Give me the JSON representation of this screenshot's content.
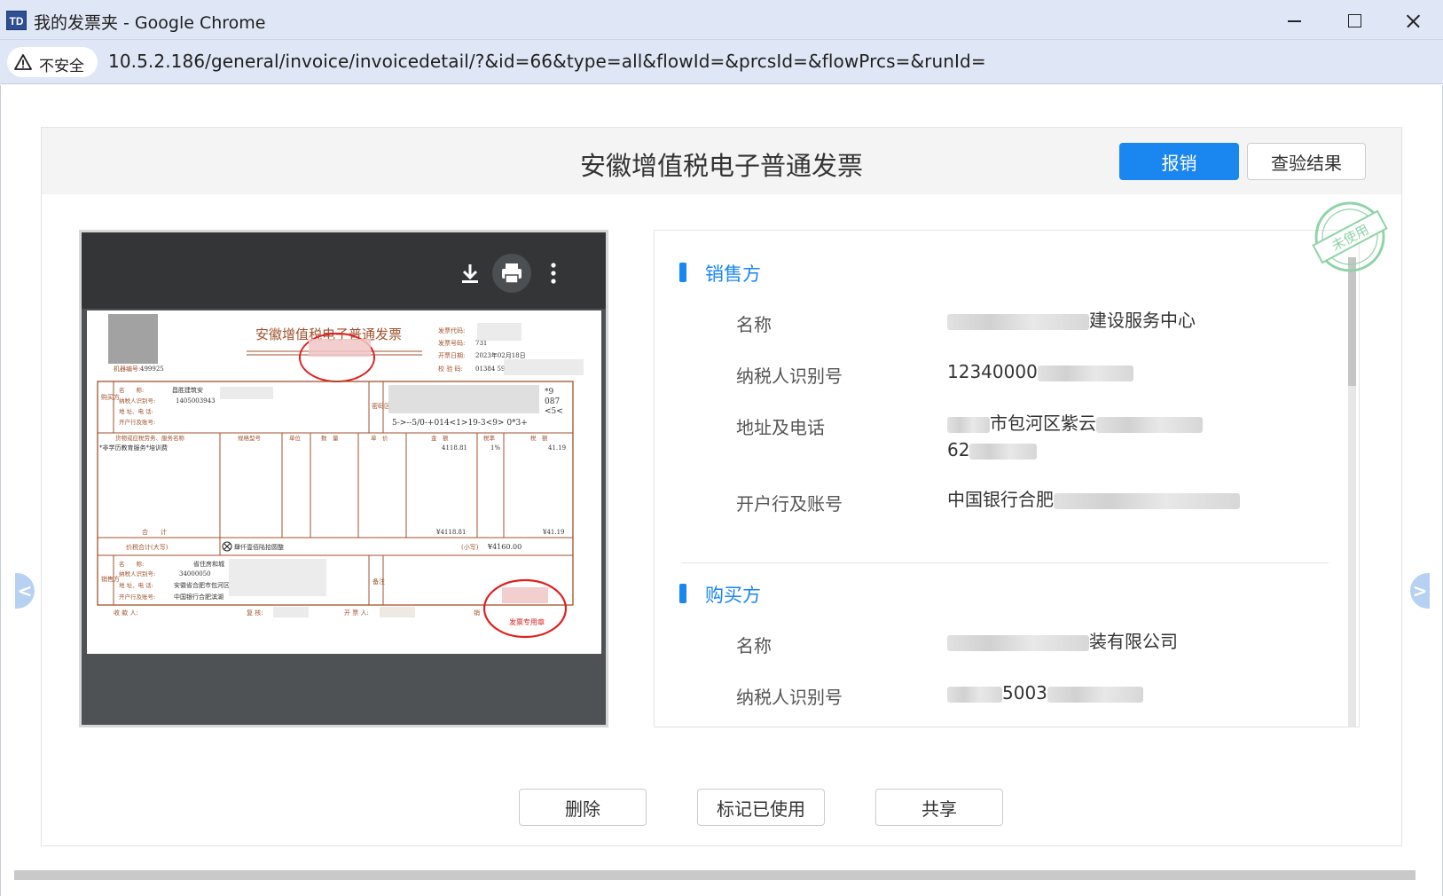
{
  "window": {
    "title": "我的发票夹 - Google Chrome",
    "app_icon_text": "TD"
  },
  "address_bar": {
    "security_label": "不安全",
    "url": "10.5.2.186/general/invoice/invoicedetail/?&id=66&type=all&flowId=&prcsId=&flowPrcs=&runId="
  },
  "panel": {
    "title": "安徽增值税电子普通发票",
    "reimburse_button": "报销",
    "verify_button": "查验结果",
    "stamp_text": "未使用"
  },
  "invoice_image": {
    "title": "安徽增值税电子普通发票",
    "invoice_code_label": "发票代码:",
    "invoice_number_label": "发票号码:",
    "invoice_number_partial": "731",
    "issue_date_label": "开票日期:",
    "issue_date": "2023年02月18日",
    "check_code_label": "校 验 码:",
    "check_code_partial": "01384 59",
    "machine_no_label": "机器编号:",
    "machine_no_partial": "499925",
    "buyer_block_label": "购买方",
    "buyer_name_partial": "昌胜建筑安",
    "buyer_tax_partial": "1405003943",
    "name_label": "名　　称:",
    "tax_id_label": "纳税人识别号:",
    "address_label": "地 址、电 话:",
    "bank_label": "开户行及账号:",
    "password_block_label": "密码区",
    "cipher_line_1": "*9",
    "cipher_line_2": "087",
    "cipher_line_3": "<5<",
    "cipher_line_4": "5->--5/0-+014<1>19-3<9> 0*3+",
    "col_item": "货物或应税劳务、服务名称",
    "col_spec": "规格型号",
    "col_unit": "单位",
    "col_qty": "数　量",
    "col_price": "单　价",
    "col_amount": "金　额",
    "col_rate": "税率",
    "col_tax": "税　额",
    "item_name": "*非学历教育服务*培训费",
    "item_amount": "4118.81",
    "item_rate": "1%",
    "item_tax": "41.19",
    "total_label": "合　　计",
    "total_amount": "¥4118.81",
    "total_tax": "¥41.19",
    "grand_label": "价税合计(大写)",
    "grand_words": "肆仟壹佰陆拾圆整",
    "grand_small_label": "(小写)",
    "grand_small": "¥4160.00",
    "seller_block_label": "销售方",
    "seller_name_partial": "省住房和城",
    "seller_tax_partial": "34000050",
    "seller_address": "安徽省合肥市包河区",
    "seller_bank": "中国银行合肥滨湖",
    "remark_label": "备注",
    "payee_label": "收 款 人:",
    "reviewer_label": "复 核:",
    "drawer_label": "开 票 人:",
    "seller_stamp_label": "销",
    "stamp_text": "发票专用章"
  },
  "seller": {
    "heading": "销售方",
    "name_label": "名称",
    "name_value": "建设服务中心",
    "tax_label": "纳税人识别号",
    "tax_value": "12340000",
    "addr_label": "地址及电话",
    "addr_value_1": "市包河区紫云",
    "addr_value_2": "62",
    "bank_label": "开户行及账号",
    "bank_value": "中国银行合肥"
  },
  "buyer": {
    "heading": "购买方",
    "name_label": "名称",
    "name_value": "装有限公司",
    "tax_label": "纳税人识别号",
    "tax_value": "5003"
  },
  "footer": {
    "delete_button": "删除",
    "mark_used_button": "标记已使用",
    "share_button": "共享"
  },
  "colors": {
    "accent": "#1a86f0",
    "invoice_ink": "#a0522d",
    "stamp_red": "#e02020",
    "stamp_green": "#8fd3a8"
  },
  "icons": [
    "warning-icon",
    "download-icon",
    "print-icon",
    "more-vert-icon",
    "chevron-left-icon",
    "chevron-right-icon",
    "close-icon",
    "minimize-icon",
    "maximize-icon"
  ]
}
